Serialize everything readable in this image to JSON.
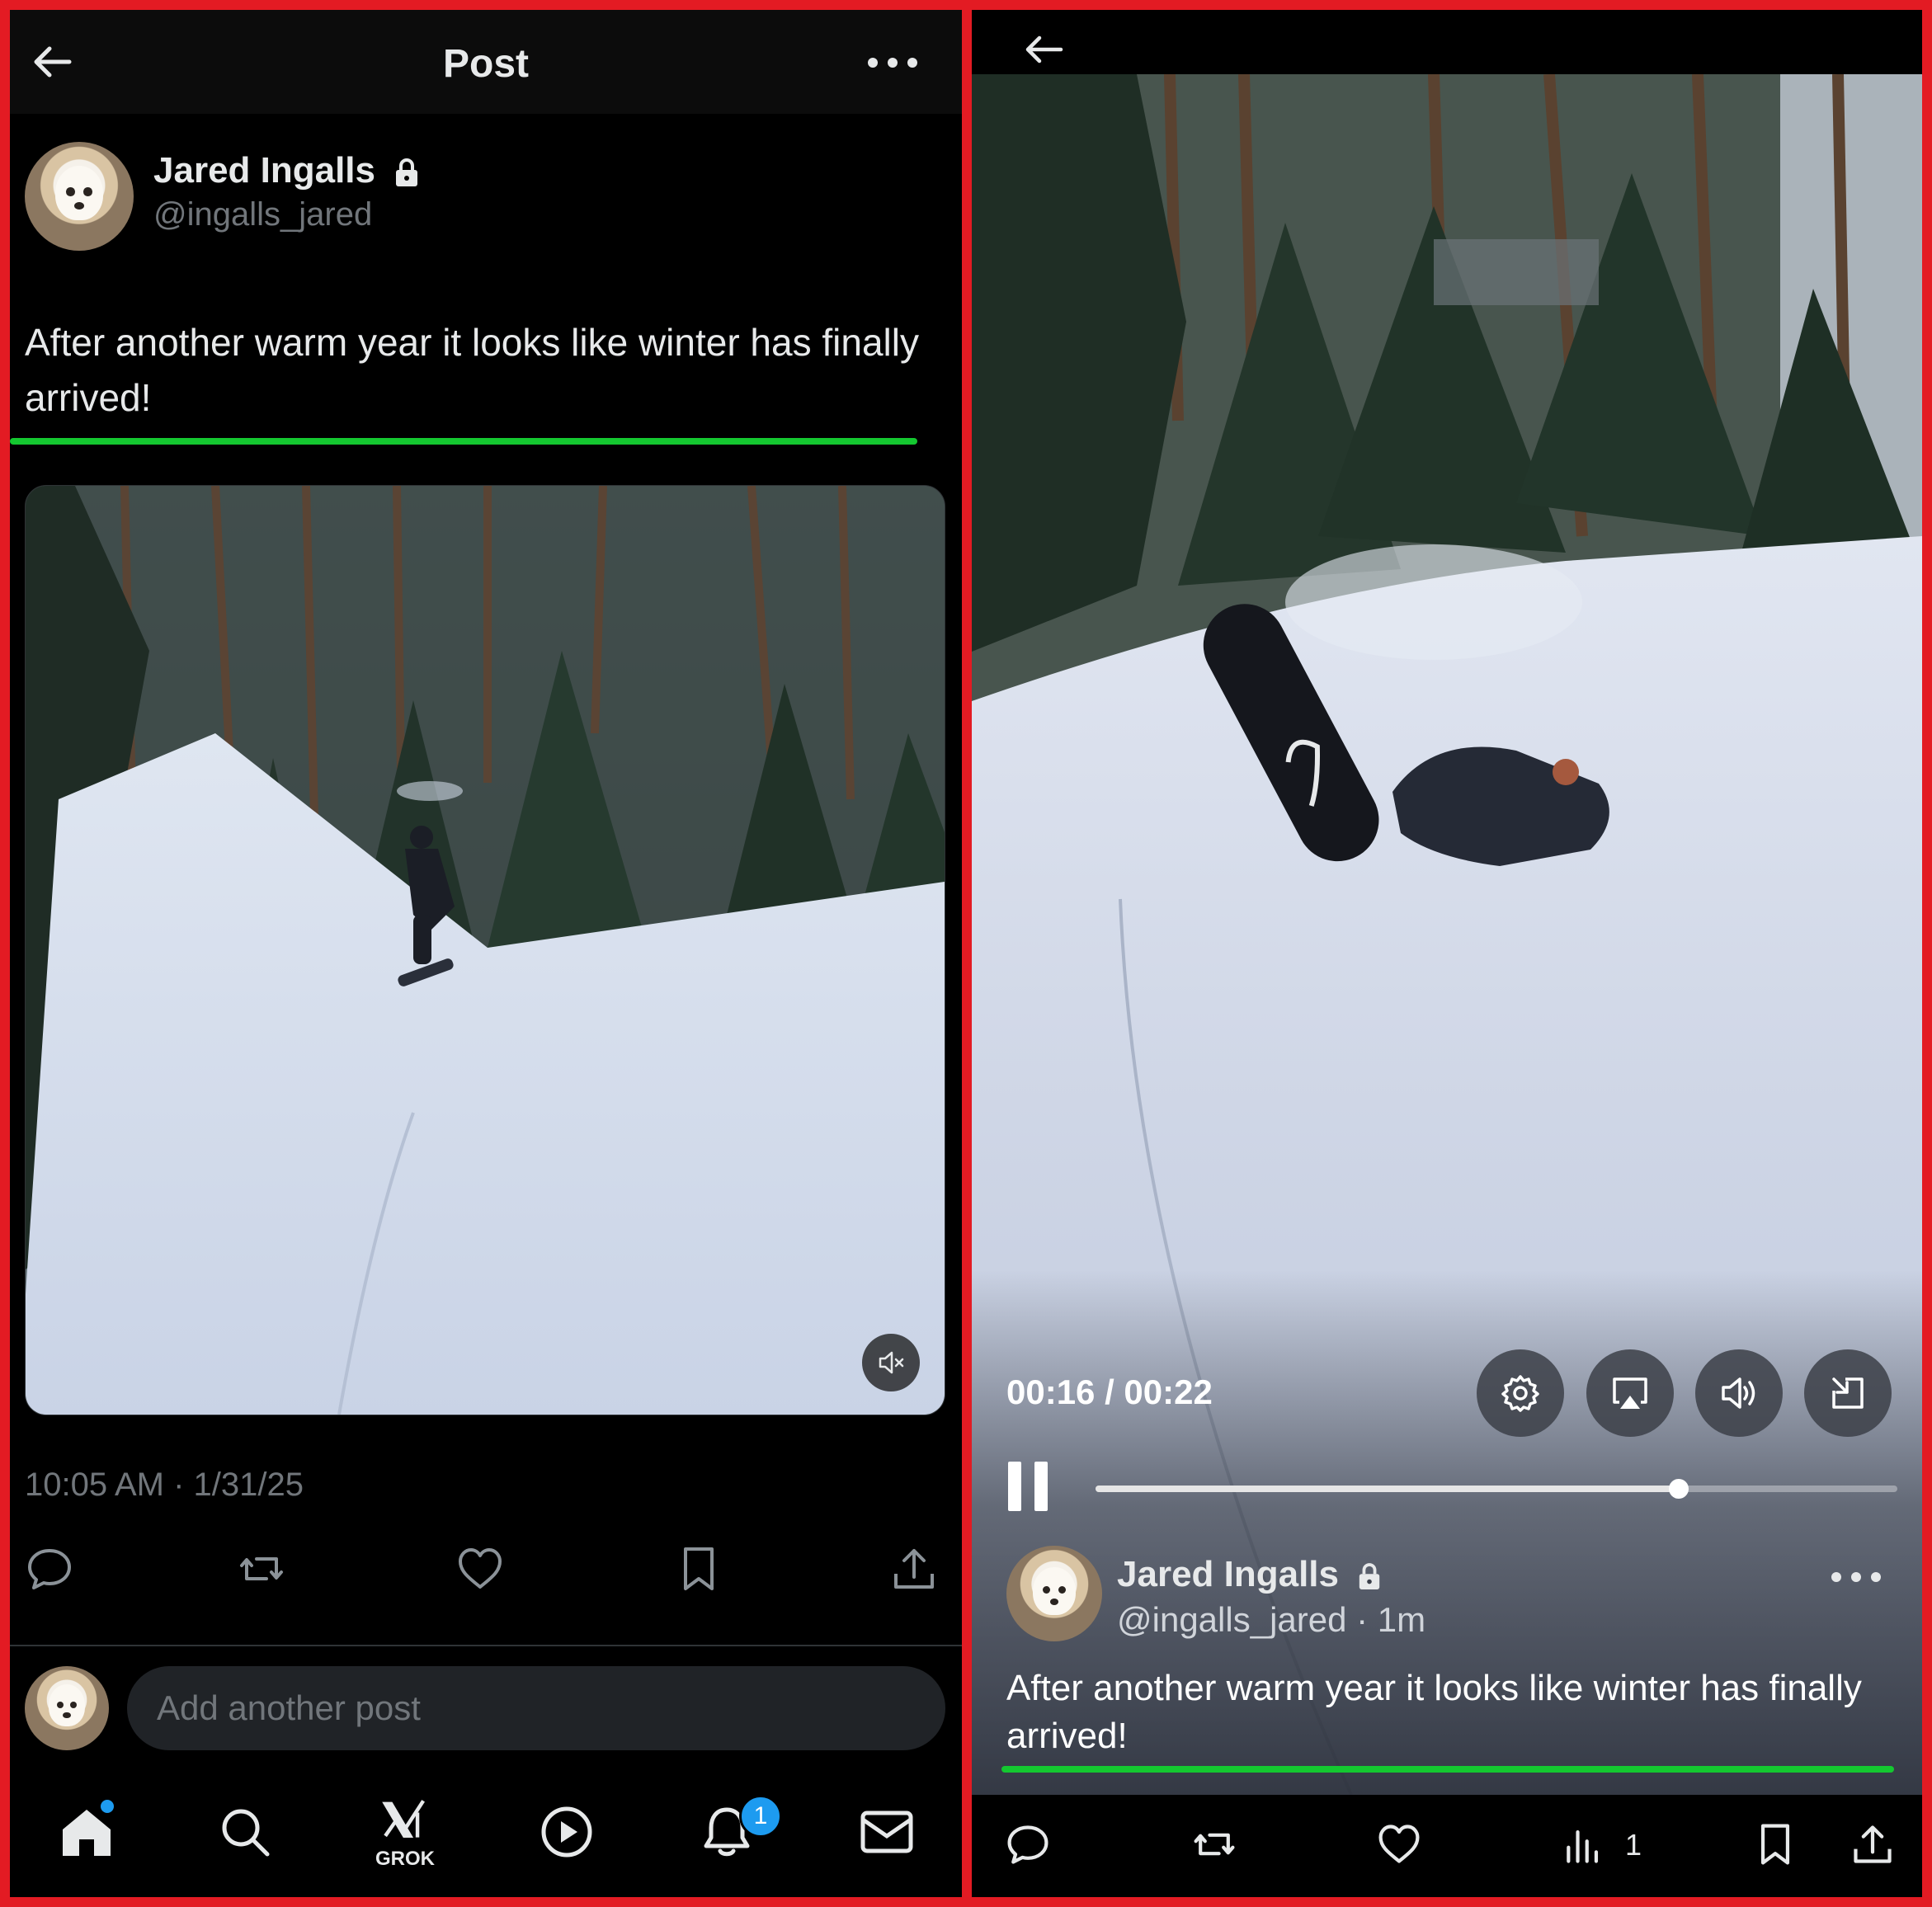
{
  "left": {
    "header": {
      "title": "Post"
    },
    "author": {
      "name": "Jared Ingalls",
      "handle": "@ingalls_jared"
    },
    "post_text": "After another warm year it looks like winter has finally arrived!",
    "timestamp": "10:05 AM · 1/31/25",
    "reply_placeholder": "Add another post",
    "nav": {
      "grok_label": "GROK",
      "notifications_badge": "1"
    }
  },
  "right": {
    "player": {
      "time": "00:16 / 00:22",
      "progress_fraction": 0.727
    },
    "author": {
      "name": "Jared Ingalls",
      "handle_time": "@ingalls_jared · 1m"
    },
    "post_text": "After another warm year it looks like winter has finally arrived!",
    "views": "1"
  },
  "colors": {
    "accent_green": "#14c830",
    "accent_blue": "#1d9bf0",
    "frame_red": "#e31b23"
  }
}
